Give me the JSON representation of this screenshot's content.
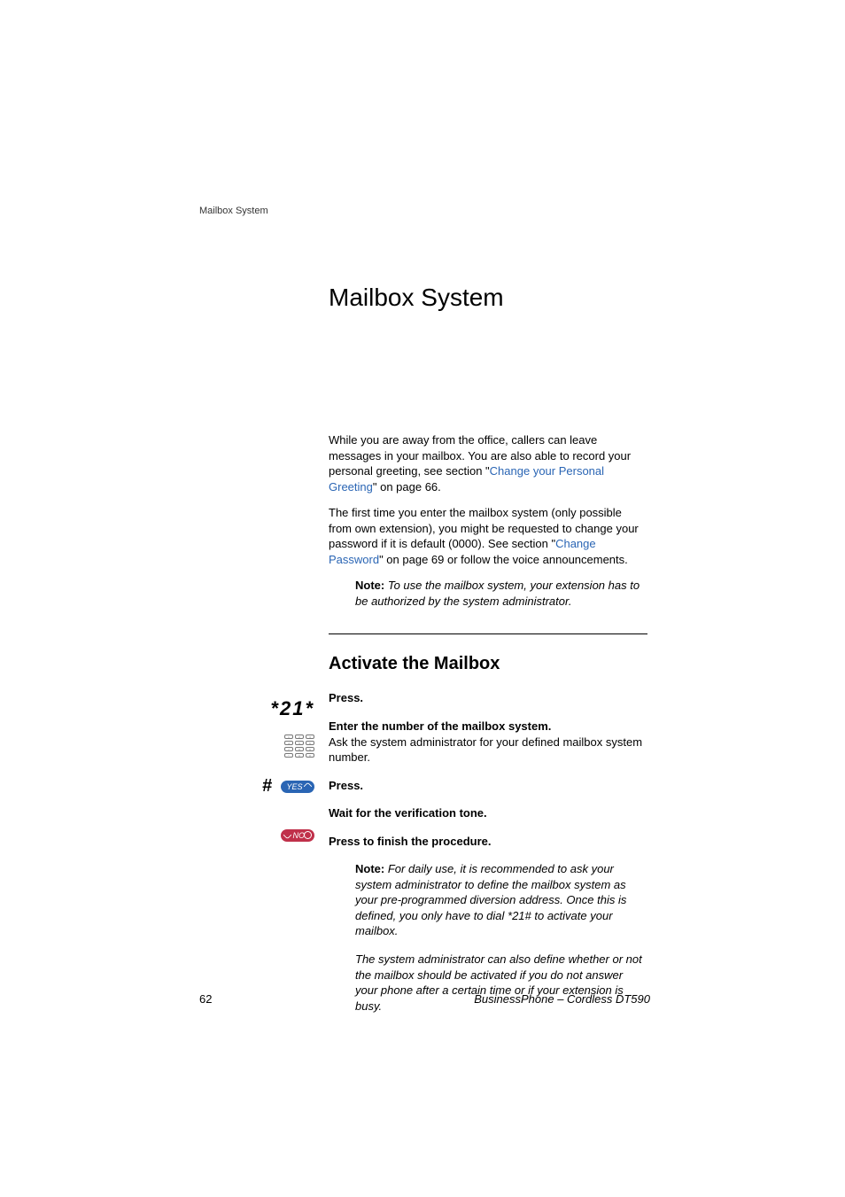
{
  "running_header": "Mailbox System",
  "title": "Mailbox System",
  "intro": {
    "p1_a": "While you are away from the office, callers can leave messages in your mailbox. You are also able to record your personal greeting, see section \"",
    "p1_link": "Change your Personal Greeting",
    "p1_b": "\" on page 66.",
    "p2_a": "The first time you enter the mailbox system (only possible from own extension), you might be requested to change your password if it is default (0000). See section \"",
    "p2_link": "Change Password",
    "p2_b": "\" on page 69 or follow the voice announcements.",
    "note_label": "Note:",
    "note_text": " To use the mailbox system, your extension has to be authorized by the system administrator."
  },
  "section": {
    "title": "Activate the Mailbox",
    "keys": {
      "dial1": "*21*",
      "hash": "#",
      "yes": "YES",
      "no": "NO"
    },
    "steps": {
      "s1": "Press.",
      "s2_bold": "Enter the number of the mailbox system.",
      "s2_text": "Ask the system administrator for your defined mailbox system number.",
      "s3": "Press.",
      "s4": "Wait for the verification tone.",
      "s5": "Press to finish the procedure.",
      "note1_label": "Note:",
      "note1_text": " For daily use, it is recommended to ask your system administrator to define the mailbox system as your pre-programmed diversion address. Once this is defined, you only have to dial *21# to activate your mailbox.",
      "note2_text": "The system administrator can also define whether or not the mailbox should be activated if you do not answer your phone after a certain time or if your extension is busy."
    }
  },
  "footer": {
    "page": "62",
    "right": "BusinessPhone – Cordless DT590"
  }
}
